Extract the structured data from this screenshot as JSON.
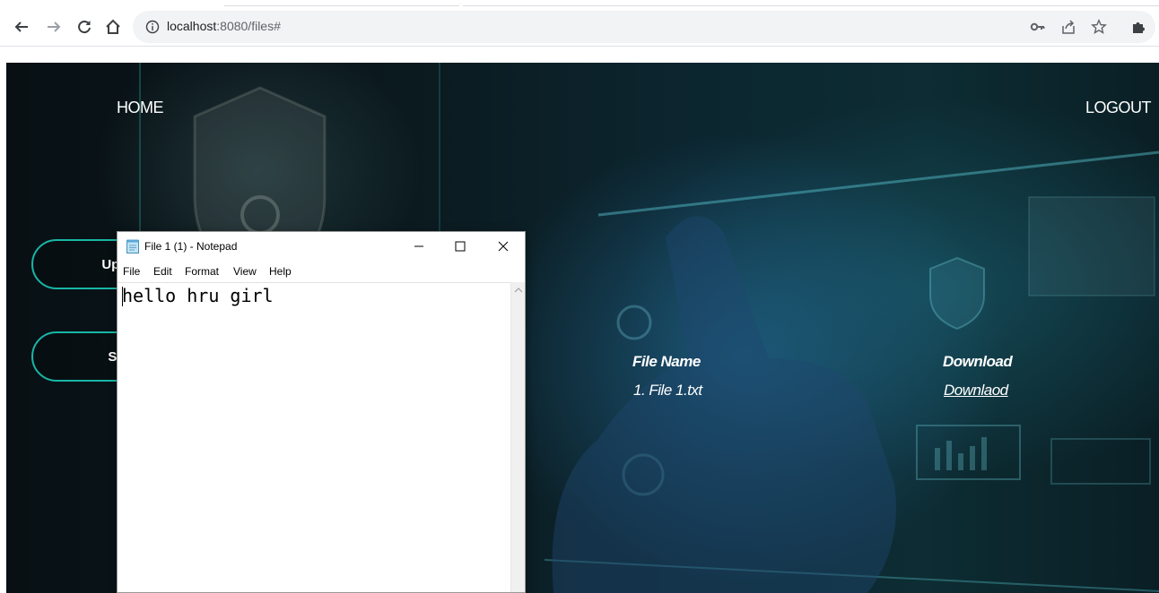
{
  "browser": {
    "url_host": "localhost",
    "url_rest": ":8080/files#",
    "icons": [
      "back-icon",
      "forward-icon",
      "reload-icon",
      "home-icon",
      "info-icon",
      "key-icon",
      "share-icon",
      "star-icon",
      "extension-icon"
    ]
  },
  "site": {
    "nav": {
      "home": "HOME",
      "logout": "LOGOUT"
    },
    "side_buttons": {
      "upload_partial": "Uplo",
      "second_partial": "Su"
    },
    "table": {
      "headers": [
        "File Name",
        "Download"
      ],
      "rows": [
        {
          "file_name": "1. File 1.txt",
          "download_link": "Downlaod"
        }
      ]
    },
    "accent": "#18b6a6"
  },
  "notepad": {
    "title": "File 1 (1) - Notepad",
    "menu": [
      "File",
      "Edit",
      "Format",
      "View",
      "Help"
    ],
    "content": "hello hru girl"
  }
}
